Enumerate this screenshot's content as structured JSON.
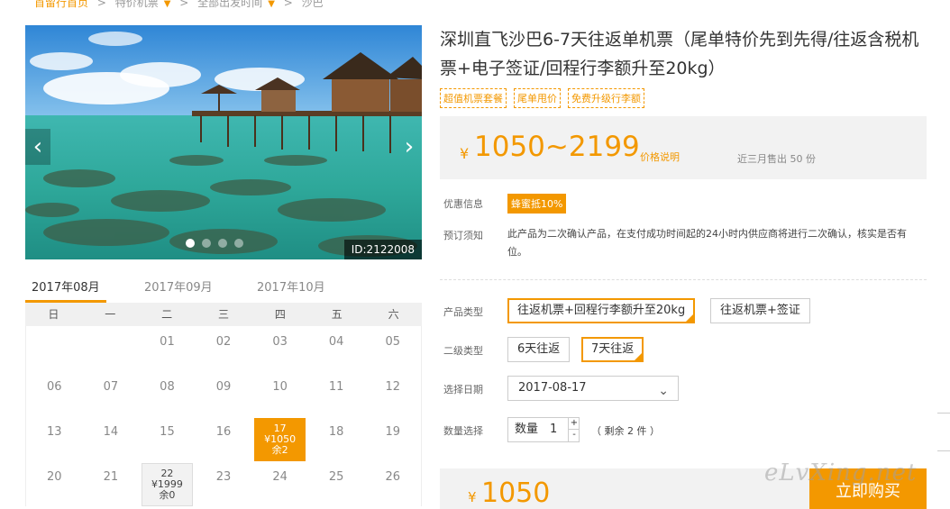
{
  "breadcrumb": {
    "home": "首留行首页",
    "cat1": "特价机票",
    "cat2": "全部出发时间",
    "current": "沙巴",
    "sep": ">"
  },
  "gallery": {
    "left_arrow": "‹",
    "right_arrow": "›",
    "id_label": "ID:2122008"
  },
  "months": [
    "2017年08月",
    "2017年09月",
    "2017年10月"
  ],
  "calendar": {
    "weekdays": [
      "日",
      "一",
      "二",
      "三",
      "四",
      "五",
      "六"
    ],
    "row1": [
      "",
      "",
      "01",
      "02",
      "03",
      "04",
      "05"
    ],
    "row2": [
      "06",
      "07",
      "08",
      "09",
      "10",
      "11",
      "12"
    ],
    "row3": [
      "13",
      "14",
      "15",
      "16",
      "",
      "18",
      "19"
    ],
    "row4": [
      "20",
      "21",
      "",
      "23",
      "24",
      "25",
      "26"
    ],
    "selected": {
      "day": "17",
      "price": "¥1050",
      "left": "余2"
    },
    "avail": {
      "day": "22",
      "price": "¥1999",
      "left": "余0"
    }
  },
  "product": {
    "title": "深圳直飞沙巴6-7天往返单机票（尾单特价先到先得/往返含税机票+电子签证/回程行李额升至20kg）",
    "tags": [
      "超值机票套餐",
      "尾单甩价",
      "免费升级行李额"
    ]
  },
  "price": {
    "currency": "¥",
    "range": "1050~2199",
    "explain": "价格说明",
    "sold": "近三月售出 50 份"
  },
  "promo": {
    "label": "优惠信息",
    "badge": "蜂蜜抵10%"
  },
  "notice": {
    "label": "预订须知",
    "text": "此产品为二次确认产品，在支付成功时间起的24小时内供应商将进行二次确认，核实是否有位。"
  },
  "options": {
    "type_label": "产品类型",
    "type_opts": [
      "往返机票+回程行李额升至20kg",
      "往返机票+签证"
    ],
    "sub_label": "二级类型",
    "sub_opts": [
      "6天往返",
      "7天往返"
    ],
    "date_label": "选择日期",
    "date_value": "2017-08-17",
    "date_chevron": "⌄",
    "qty_label": "数量选择",
    "qty_inner_label": "数量",
    "qty_value": "1",
    "qty_plus": "+",
    "qty_minus": "-",
    "remain": "（ 剩余 2 件 ）"
  },
  "checkout": {
    "currency": "¥",
    "amount": "1050",
    "buy_label": "立即购买"
  },
  "watermark": "eLvXing.net",
  "colors": {
    "accent": "#f39800",
    "panel_bg": "#f2f2f2"
  }
}
